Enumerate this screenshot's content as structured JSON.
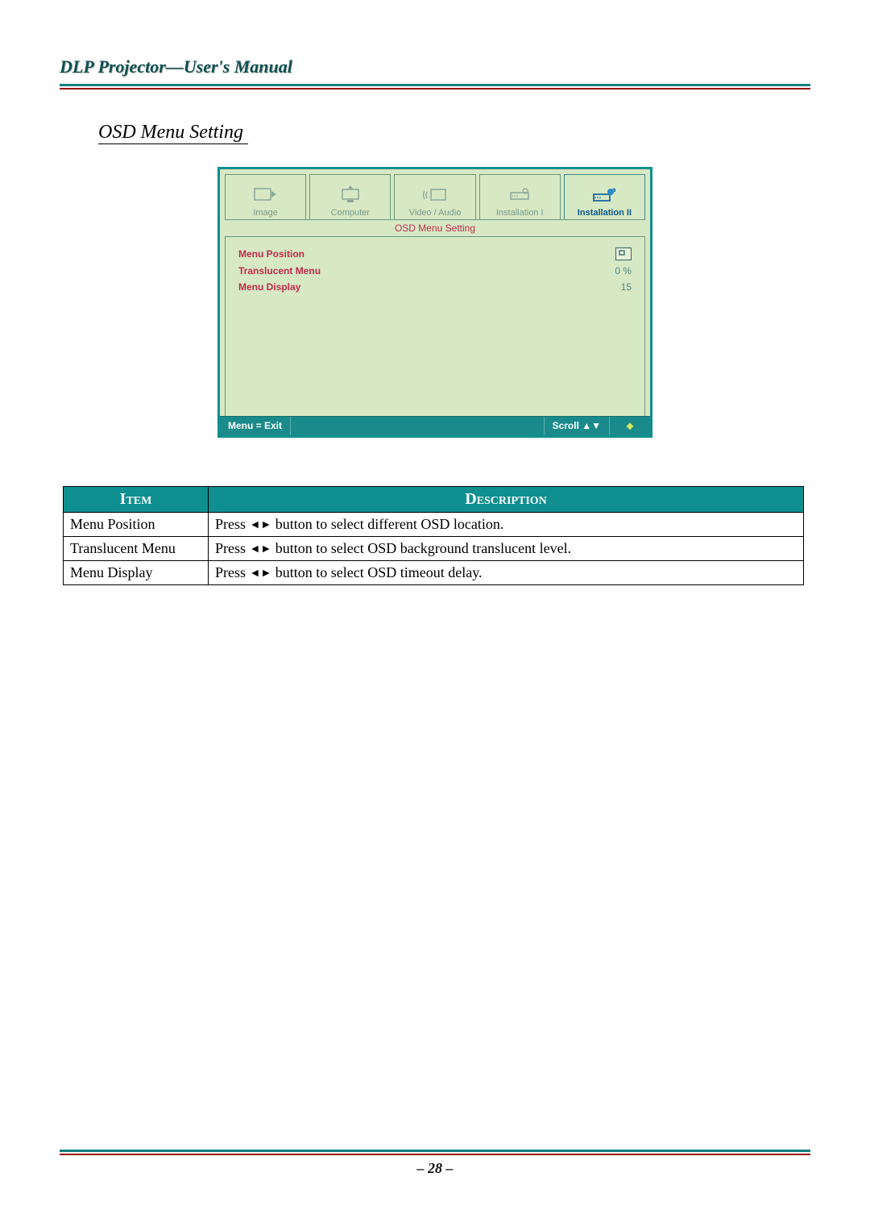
{
  "header": {
    "title": "DLP Projector—User's Manual"
  },
  "section": {
    "title": "OSD Menu Setting"
  },
  "osd": {
    "tabs": [
      {
        "label": "Image"
      },
      {
        "label": "Computer"
      },
      {
        "label": "Video / Audio"
      },
      {
        "label": "Installation I"
      },
      {
        "label": "Installation II"
      }
    ],
    "subtitle": "OSD Menu Setting",
    "rows": [
      {
        "label": "Menu Position",
        "value": "▣"
      },
      {
        "label": "Translucent Menu",
        "value": "0 %"
      },
      {
        "label": "Menu Display",
        "value": "15"
      }
    ],
    "footer": {
      "left": "Menu = Exit",
      "right": "Scroll ▲▼",
      "hint": "⬥"
    }
  },
  "table": {
    "headers": {
      "item": "Item",
      "desc": "Description"
    },
    "rows": [
      {
        "item": "Menu Position",
        "desc_pre": "Press ",
        "arrows": "◄►",
        "desc_post": " button to select different OSD location."
      },
      {
        "item": "Translucent Menu",
        "desc_pre": "Press ",
        "arrows": "◄►",
        "desc_post": " button to select OSD background translucent level."
      },
      {
        "item": "Menu Display",
        "desc_pre": "Press ",
        "arrows": "◄►",
        "desc_post": " button to select OSD timeout delay."
      }
    ]
  },
  "footer": {
    "page": "– 28 –"
  }
}
